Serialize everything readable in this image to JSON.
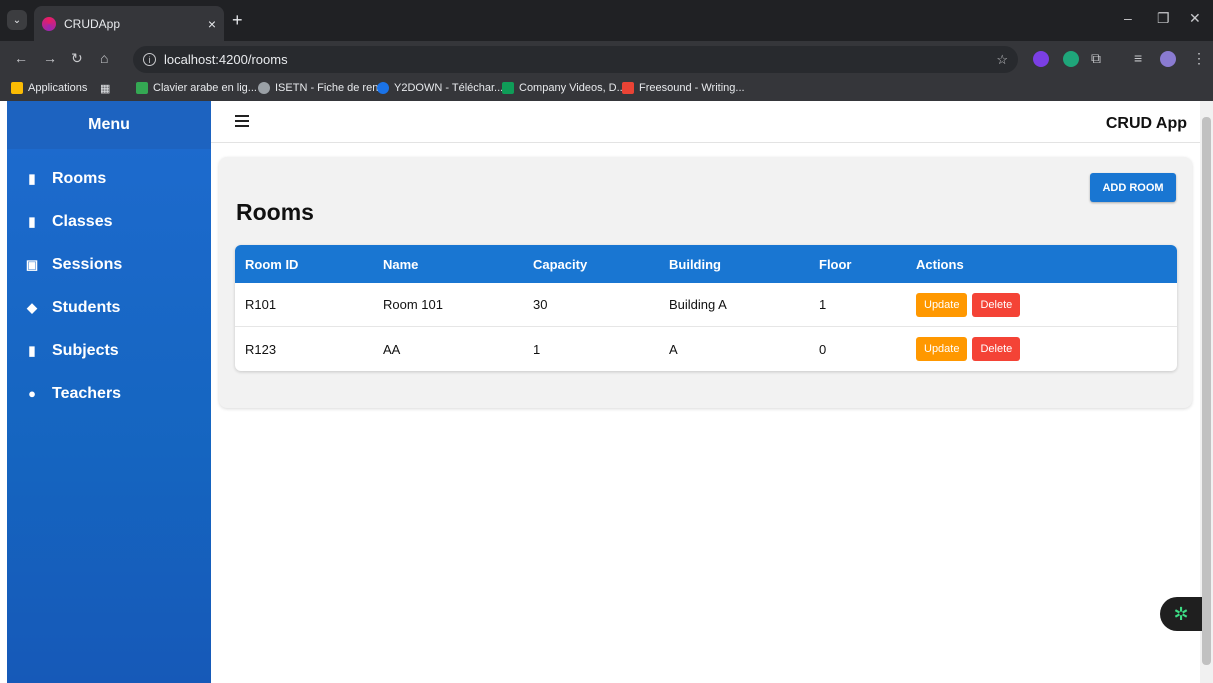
{
  "browser": {
    "tab_title": "CRUDApp",
    "url": "localhost:4200/rooms",
    "bookmarks": [
      {
        "label": "Applications",
        "color": "#fbbc04"
      },
      {
        "label": "Clavier arabe en lig...",
        "color": "#34a853"
      },
      {
        "label": "ISETN - Fiche de ren...",
        "color": "#9aa0a6"
      },
      {
        "label": "Y2DOWN - Téléchar...",
        "color": "#1a73e8"
      },
      {
        "label": "Company Videos, D...",
        "color": "#0f9d58"
      },
      {
        "label": "Freesound - Writing...",
        "color": "#ea4335"
      }
    ]
  },
  "sidebar": {
    "title": "Menu",
    "items": [
      {
        "label": "Rooms",
        "icon": "door-icon"
      },
      {
        "label": "Classes",
        "icon": "book-icon"
      },
      {
        "label": "Sessions",
        "icon": "calendar-icon"
      },
      {
        "label": "Students",
        "icon": "graduation-cap-icon"
      },
      {
        "label": "Subjects",
        "icon": "book-icon"
      },
      {
        "label": "Teachers",
        "icon": "person-icon"
      }
    ]
  },
  "header": {
    "app_title": "CRUD App"
  },
  "main": {
    "title": "Rooms",
    "add_button": "ADD ROOM",
    "columns": [
      "Room ID",
      "Name",
      "Capacity",
      "Building",
      "Floor",
      "Actions"
    ],
    "rows": [
      {
        "id": "R101",
        "name": "Room 101",
        "capacity": "30",
        "building": "Building A",
        "floor": "1"
      },
      {
        "id": "R123",
        "name": "AA",
        "capacity": "1",
        "building": "A",
        "floor": "0"
      }
    ],
    "update_label": "Update",
    "delete_label": "Delete"
  },
  "colors": {
    "primary": "#1976d2",
    "update": "#ff9800",
    "delete": "#f44336"
  }
}
